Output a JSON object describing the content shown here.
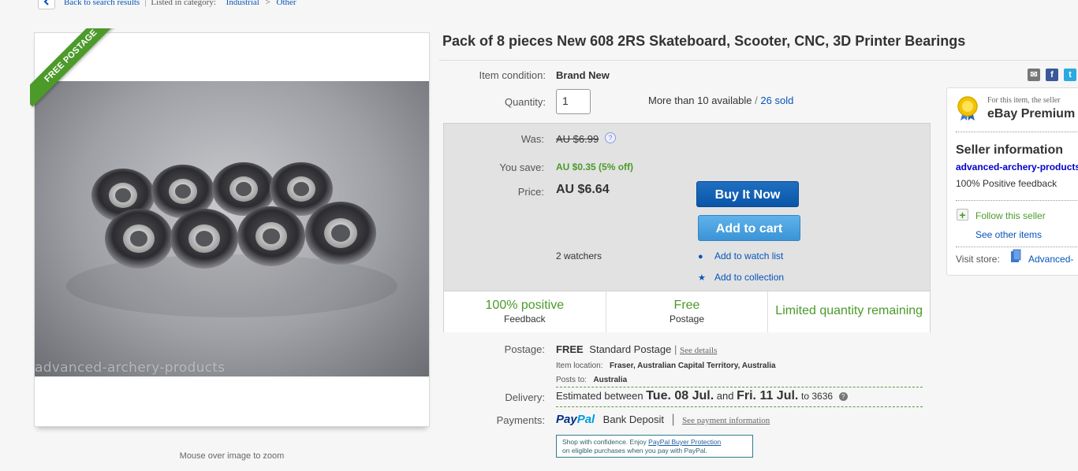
{
  "breadcrumb": {
    "back_label": "Back to search results",
    "listed_prefix": "Listed in category:",
    "category": "Industrial",
    "separator": ">",
    "subcategory": "Other"
  },
  "image_panel": {
    "ribbon": "FREE POSTAGE",
    "watermark": "advanced-archery-products",
    "zoom_hint": "Mouse over image to zoom"
  },
  "listing": {
    "title": "Pack of 8 pieces New 608 2RS Skateboard, Scooter, CNC, 3D Printer Bearings",
    "condition_label": "Item condition:",
    "condition_value": "Brand New",
    "quantity_label": "Quantity:",
    "quantity_value": "1",
    "availability": "More than 10 available",
    "availability_sep": "/",
    "sold": "26 sold"
  },
  "pricing": {
    "was_label": "Was:",
    "was_value": "AU $6.99",
    "help": "?",
    "save_label": "You save:",
    "save_value": "AU $0.35 (5% off)",
    "price_label": "Price:",
    "price_value": "AU $6.64",
    "buy_now": "Buy It Now",
    "add_to_cart": "Add to cart",
    "watchers": "2 watchers",
    "watch_list": "Add to watch list",
    "collection": "Add to collection"
  },
  "stats": [
    {
      "big": "100% positive",
      "small": "Feedback"
    },
    {
      "big": "Free",
      "small": "Postage"
    },
    {
      "big": "Limited quantity remaining",
      "small": ""
    }
  ],
  "shipping": {
    "postage_label": "Postage:",
    "postage_free": "FREE",
    "postage_type": "Standard Postage",
    "pipe": "|",
    "see_details": "See details",
    "location_label": "Item location:",
    "location_value": "Fraser, Australian Capital Territory, Australia",
    "posts_label": "Posts to:",
    "posts_value": "Australia",
    "delivery_label": "Delivery:",
    "delivery_prefix": "Estimated between",
    "delivery_start": "Tue. 08 Jul.",
    "delivery_and": "and",
    "delivery_end": "Fri. 11 Jul.",
    "delivery_to": "to 3636",
    "payments_label": "Payments:",
    "paypal_pay": "Pay",
    "paypal_pal": "Pal",
    "bank_deposit": "Bank Deposit",
    "see_payment": "See payment information",
    "pp_note_line1_a": "Shop with confidence. Enjoy ",
    "pp_note_link": "PayPal Buyer Protection",
    "pp_note_line2": "on eligible purchases when you pay with PayPal."
  },
  "seller": {
    "premium_note": "For this item, the seller",
    "premium_title": "eBay Premium",
    "info_heading": "Seller information",
    "name": "advanced-archery-products",
    "feedback": "100% Positive feedback",
    "follow": "Follow this seller",
    "see_items": "See other items",
    "visit_label": "Visit store:",
    "store_name": "Advanced-"
  },
  "colors": {
    "link": "#0654ba",
    "green": "#4c9a2a",
    "buy_button": "#0a55a8",
    "cart_button": "#3b94d6"
  }
}
